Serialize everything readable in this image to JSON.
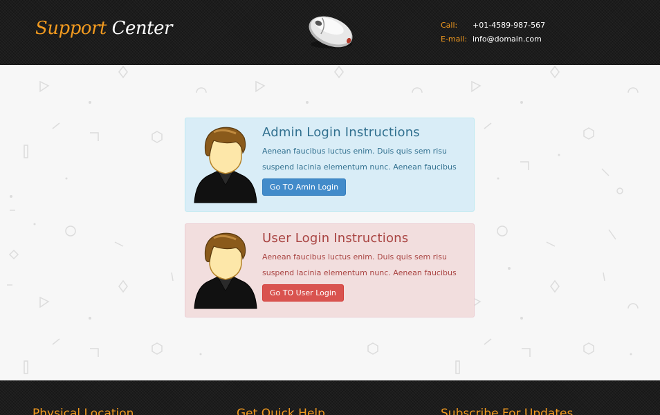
{
  "header": {
    "brand_primary": "Support",
    "brand_secondary": "Center",
    "logo_icon": "computer-mouse-icon",
    "contact": {
      "call_label": "Call:",
      "call_value": "+01-4589-987-567",
      "email_label": "E-mail:",
      "email_value": "info@domain.com"
    }
  },
  "panels": {
    "admin": {
      "avatar_icon": "user-avatar-icon",
      "title": "Admin Login Instructions",
      "description": "Aenean faucibus luctus enim. Duis quis sem risu suspend lacinia elementum nunc. Aenean faucibus luctus enim.",
      "button_label": "Go TO Amin Login"
    },
    "user": {
      "avatar_icon": "user-avatar-icon",
      "title": "User Login Instructions",
      "description": "Aenean faucibus luctus enim. Duis quis sem risu suspend lacinia elementum nunc. Aenean faucibus luctus enim.",
      "button_label": "Go TO User Login"
    }
  },
  "footer": {
    "col1_title": "Physical Location",
    "col2_title": "Get Quick Help",
    "col3_title": "Subscribe For Updates"
  },
  "colors": {
    "accent_orange": "#f29a1f",
    "header_bg": "#1c1c1c",
    "info_bg": "#d9edf7",
    "danger_bg": "#f2dede",
    "primary_button": "#428bca",
    "danger_button": "#d9534f"
  }
}
